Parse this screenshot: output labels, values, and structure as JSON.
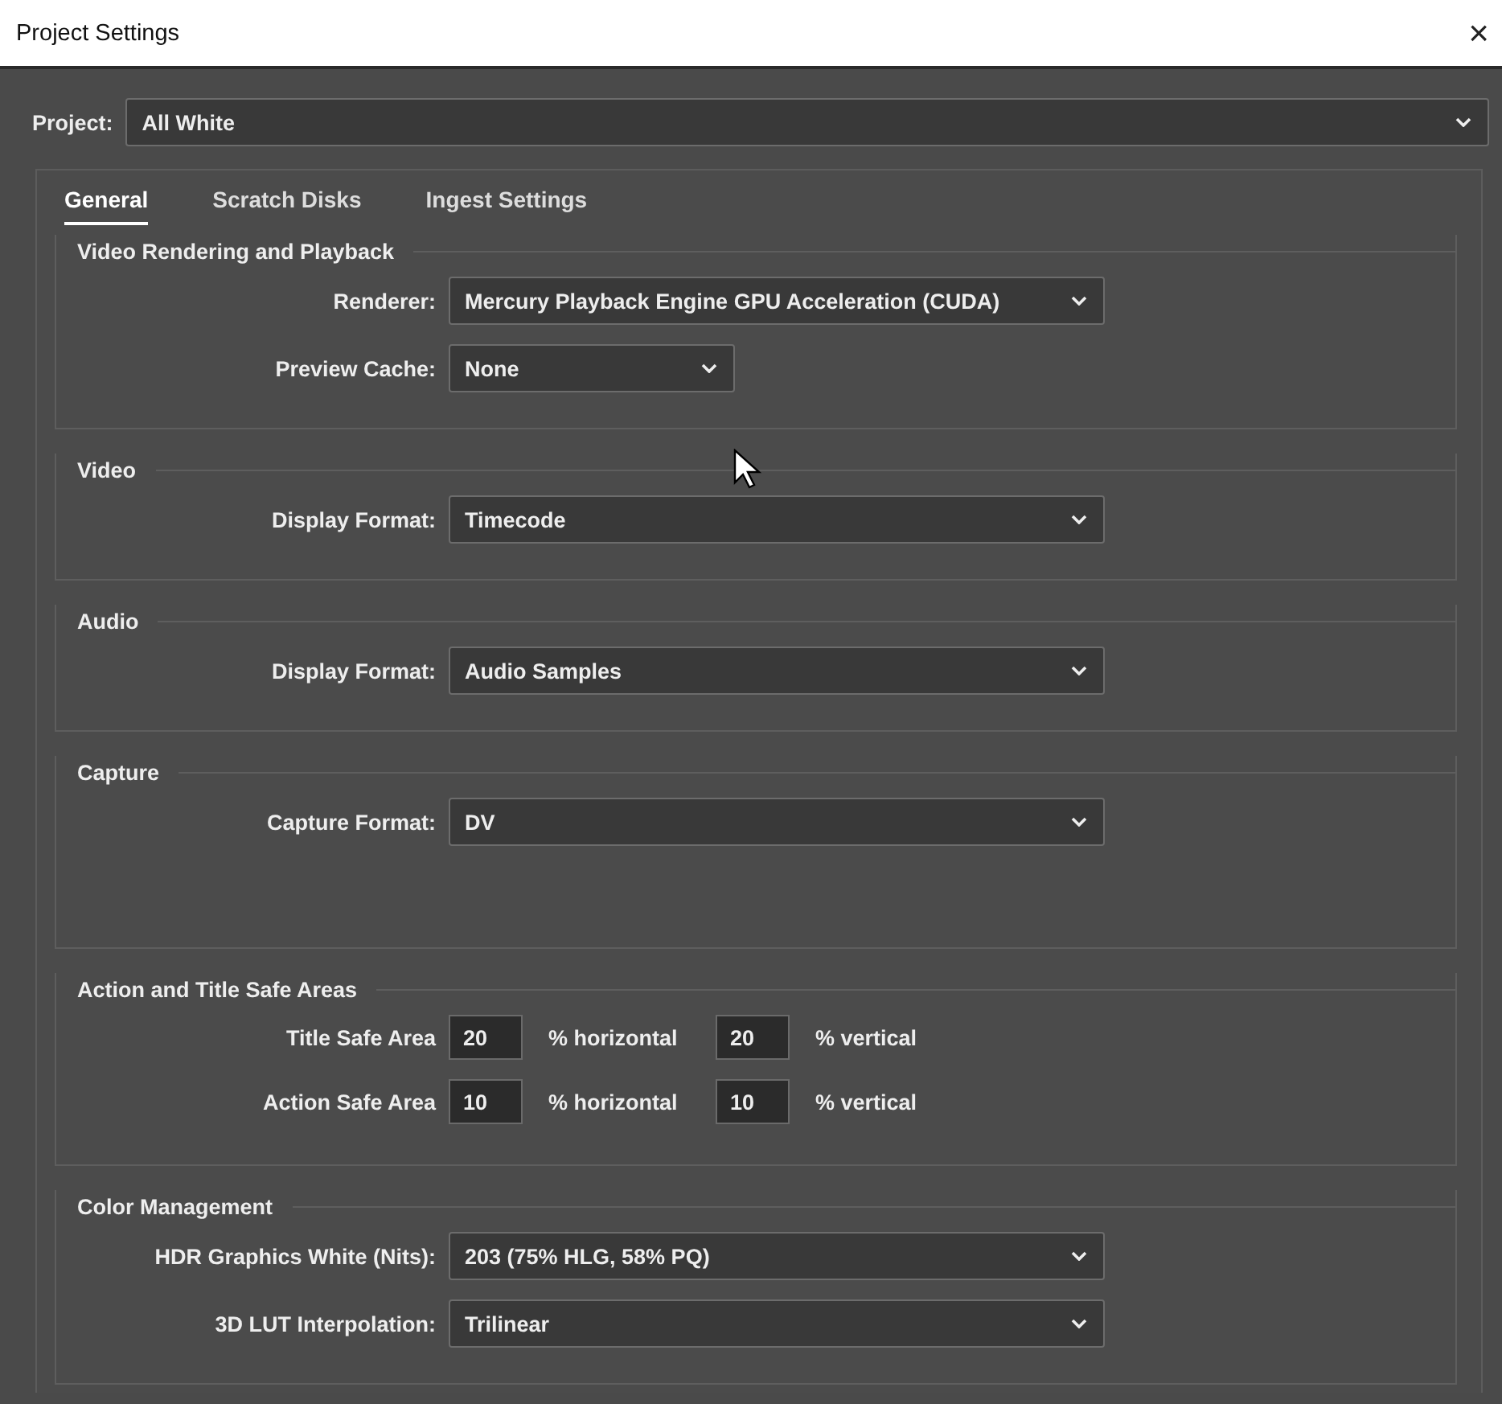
{
  "window": {
    "title": "Project Settings",
    "close": "×"
  },
  "project": {
    "label": "Project:",
    "value": "All White"
  },
  "tabs": [
    {
      "label": "General",
      "selected": true
    },
    {
      "label": "Scratch Disks",
      "selected": false
    },
    {
      "label": "Ingest Settings",
      "selected": false
    }
  ],
  "sections": [
    {
      "title": "Video Rendering and Playback",
      "rows": [
        {
          "kind": "dropdown",
          "label": "Renderer:",
          "value": "Mercury Playback Engine GPU Acceleration (CUDA)"
        },
        {
          "kind": "short-dropdown",
          "label": "Preview Cache:",
          "value": "None"
        }
      ]
    },
    {
      "title": "Video",
      "rows": [
        {
          "kind": "dropdown",
          "label": "Display Format:",
          "value": "Timecode"
        }
      ]
    },
    {
      "title": "Audio",
      "rows": [
        {
          "kind": "dropdown",
          "label": "Display Format:",
          "value": "Audio Samples"
        }
      ]
    },
    {
      "title": "Capture",
      "rows": [
        {
          "kind": "dropdown",
          "label": "Capture Format:",
          "value": "DV"
        }
      ]
    },
    {
      "title": "Action and Title Safe Areas",
      "rows": [
        {
          "kind": "percent-pair",
          "label": "Title Safe Area",
          "horizontal": "20",
          "horizontal_unit": "% horizontal",
          "vertical": "20",
          "vertical_unit": "% vertical"
        },
        {
          "kind": "percent-pair",
          "label": "Action Safe Area",
          "horizontal": "10",
          "horizontal_unit": "% horizontal",
          "vertical": "10",
          "vertical_unit": "% vertical"
        }
      ]
    },
    {
      "title": "Color Management",
      "rows": [
        {
          "kind": "dropdown",
          "label": "HDR Graphics White (Nits):",
          "value": "203 (75% HLG, 58% PQ)"
        },
        {
          "kind": "dropdown",
          "label": "3D LUT Interpolation:",
          "value": "Trilinear"
        }
      ]
    }
  ]
}
